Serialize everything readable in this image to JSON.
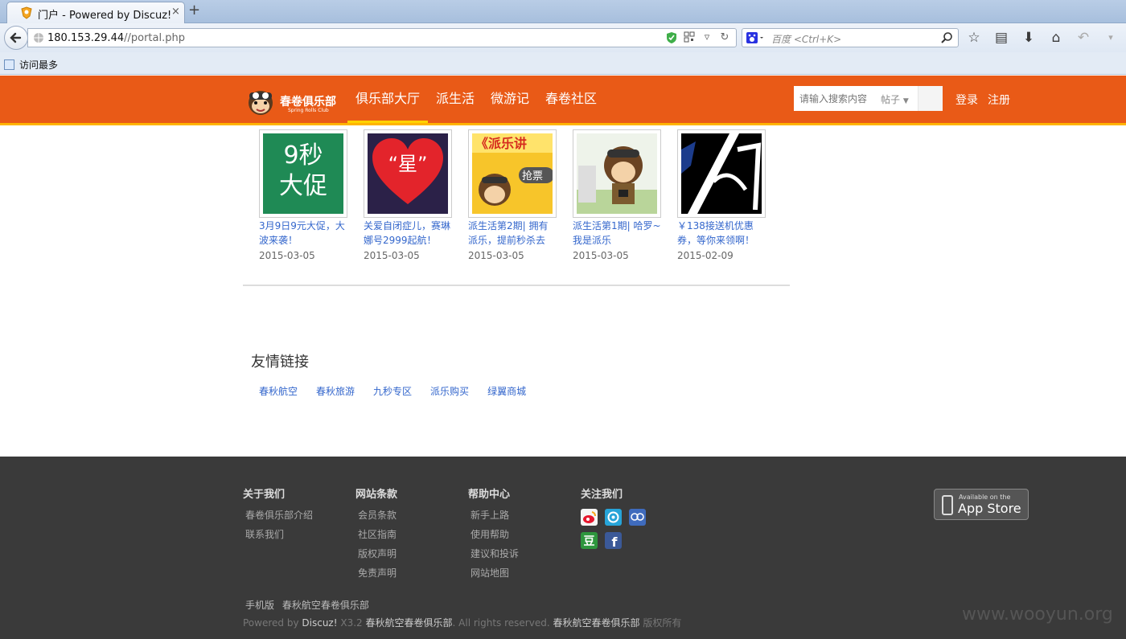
{
  "browser": {
    "tab_title": "门户 - Powered by Discuz!",
    "tab_close": "×",
    "new_tab": "+",
    "url_host": "180.153.29.44",
    "url_path": "//portal.php",
    "search_placeholder": "百度 <Ctrl+K>",
    "bookmark_label": "访问最多"
  },
  "header": {
    "logo_text": "春卷俱乐部",
    "logo_sub": "Spring Rolls Club",
    "nav": [
      {
        "label": "俱乐部大厅",
        "active": true
      },
      {
        "label": "派生活"
      },
      {
        "label": "微游记"
      },
      {
        "label": "春卷社区"
      }
    ],
    "search_placeholder": "请输入搜索内容",
    "search_type": "帖子",
    "login": "登录",
    "register": "注册"
  },
  "articles": [
    {
      "title": "3月9日9元大促，大波来袭！",
      "date": "2015-03-05",
      "thumb_text": "9秒大促"
    },
    {
      "title": "关爱自闭症儿，赛琳娜号2999起航！",
      "date": "2015-03-05",
      "thumb_text": "“星”"
    },
    {
      "title": "派生活第2期| 拥有派乐，提前秒杀去",
      "date": "2015-03-05",
      "thumb_text": "《派乐讲"
    },
    {
      "title": "派生活第1期| 哈罗~我是派乐",
      "date": "2015-03-05",
      "thumb_text": ""
    },
    {
      "title": "￥138接送机优惠券，等你来领啊！",
      "date": "2015-02-09",
      "thumb_text": ""
    }
  ],
  "friend_links": {
    "title": "友情链接",
    "items": [
      "春秋航空",
      "春秋旅游",
      "九秒专区",
      "派乐购买",
      "绿翼商城"
    ]
  },
  "footer": {
    "columns": [
      {
        "title": "关于我们",
        "links": [
          "春卷俱乐部介绍",
          "联系我们"
        ]
      },
      {
        "title": "网站条款",
        "links": [
          "会员条款",
          "社区指南",
          "版权声明",
          "免责声明"
        ]
      },
      {
        "title": "帮助中心",
        "links": [
          "新手上路",
          "使用帮助",
          "建议和投诉",
          "网站地图"
        ]
      },
      {
        "title": "关注我们",
        "links": []
      }
    ],
    "appstore_small": "Available on the",
    "appstore_big": "App Store",
    "mobile": "手机版",
    "site_name": "春秋航空春卷俱乐部",
    "powered_by": "Powered by",
    "discuz": "Discuz!",
    "version": "X3.2",
    "company": "春秋航空春卷俱乐部",
    "rights": ". All rights reserved.",
    "company2": "春秋航空春卷俱乐部",
    "copyright": "版权所有",
    "watermark": "www.wooyun.org"
  },
  "colors": {
    "header_bg": "#e95a17",
    "header_underline": "#ffb400",
    "link": "#3366cc",
    "footer_bg": "#3a3a3a"
  }
}
